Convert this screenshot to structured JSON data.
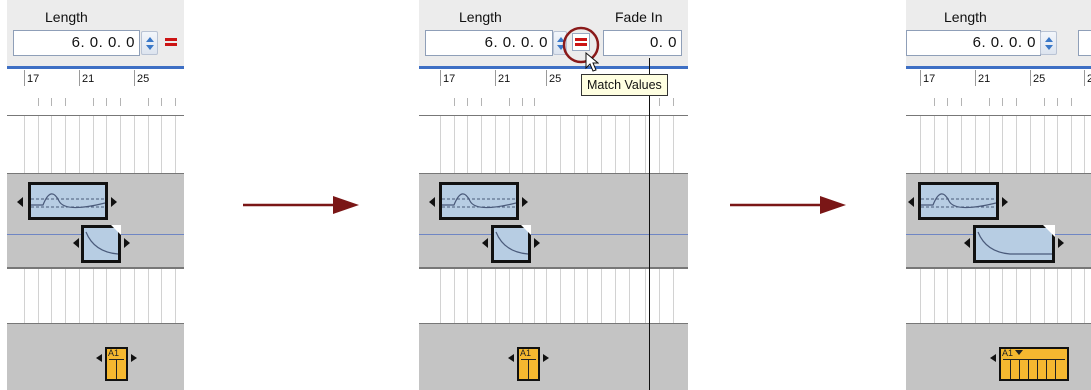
{
  "length_label": "Length",
  "fade_in_label": "Fade In",
  "length_value": "6. 0. 0. 0",
  "fade_in_value": "0. 0",
  "tooltip": "Match Values",
  "ruler_labels": [
    "17",
    "21",
    "25"
  ],
  "ruler_label_partial": "25",
  "clip_marker": "A1",
  "colors": {
    "accent_blue": "#3e6fc4",
    "match_red": "#cc1414",
    "arrow": "#7a1616",
    "clip_blue": "#b7cde3",
    "clip_yellow": "#f5b830",
    "track_gray": "#c4c4c4"
  },
  "icons": [
    "spinner-icon",
    "match-values-icon",
    "mouse-pointer-icon",
    "right-arrow-icon"
  ]
}
